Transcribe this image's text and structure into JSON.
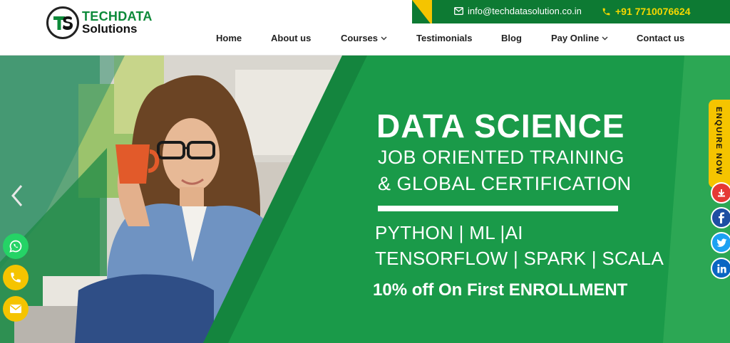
{
  "header": {
    "logo": {
      "line1": "TECHDATA",
      "line2": "Solutions",
      "badge_text": "TS"
    },
    "email": "info@techdatasolution.co.in",
    "phone": "+91 7710076624",
    "nav": [
      {
        "label": "Home",
        "has_dropdown": false
      },
      {
        "label": "About us",
        "has_dropdown": false
      },
      {
        "label": "Courses",
        "has_dropdown": true
      },
      {
        "label": "Testimonials",
        "has_dropdown": false
      },
      {
        "label": "Blog",
        "has_dropdown": false
      },
      {
        "label": "Pay Online",
        "has_dropdown": true
      },
      {
        "label": "Contact us",
        "has_dropdown": false
      }
    ]
  },
  "hero": {
    "title": "DATA SCIENCE",
    "subtitle_line1": "JOB ORIENTED TRAINING",
    "subtitle_line2": "& GLOBAL CERTIFICATION",
    "tech_line1": "PYTHON | ML |AI",
    "tech_line2": "TENSORFLOW | SPARK | SCALA",
    "offer": "10% off On First ENROLLMENT"
  },
  "side": {
    "enquire_label": "ENQUIRE NOW",
    "social": [
      {
        "name": "download-icon",
        "color": "#e53935"
      },
      {
        "name": "facebook-icon",
        "color": "#1e4fa3"
      },
      {
        "name": "twitter-icon",
        "color": "#1da1f2"
      },
      {
        "name": "linkedin-icon",
        "color": "#0a66c2"
      }
    ]
  },
  "floating": [
    {
      "name": "whatsapp-icon",
      "color": "#25d366"
    },
    {
      "name": "phone-icon",
      "color": "#f5c400"
    },
    {
      "name": "mail-icon",
      "color": "#f5c400"
    }
  ],
  "colors": {
    "brand_green": "#0d7a33",
    "accent_yellow": "#f5c400",
    "hero_green": "#1a9a49"
  }
}
